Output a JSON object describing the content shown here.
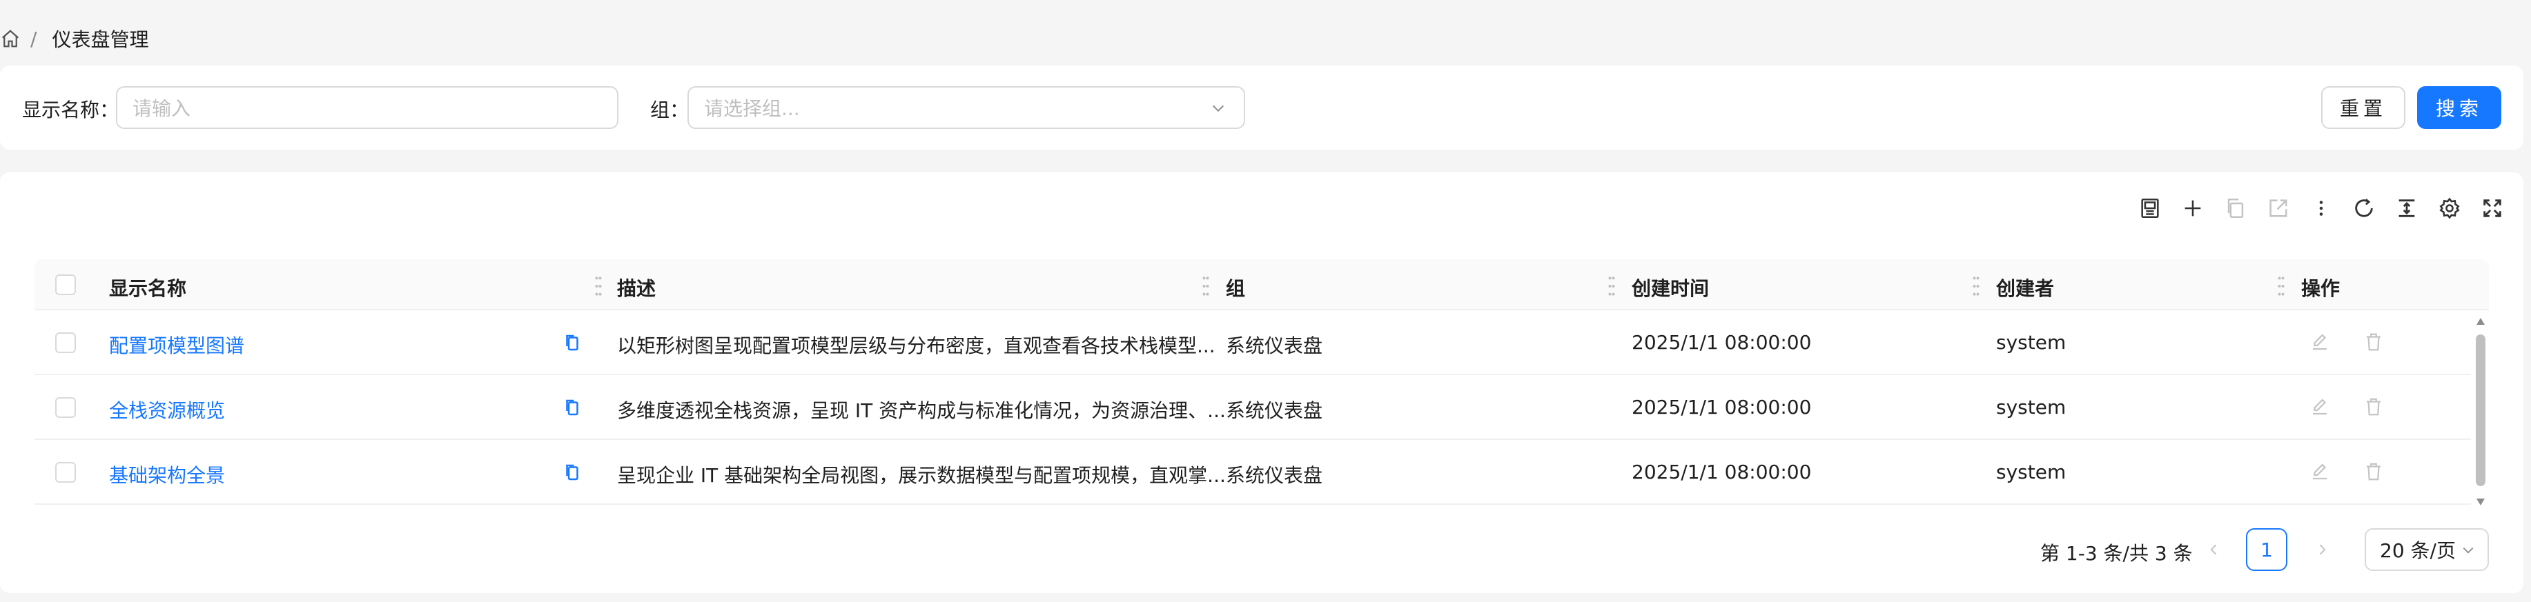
{
  "breadcrumb": {
    "separator": "/",
    "current": "仪表盘管理"
  },
  "search": {
    "name_label": "显示名称：",
    "name_placeholder": "请输入",
    "group_label": "组：",
    "group_placeholder": "请选择组...",
    "reset_label": "重置",
    "search_label": "搜索"
  },
  "toolbar": {
    "icons": [
      "import-icon",
      "add-icon",
      "copy-icon",
      "export-icon",
      "more-icon",
      "reload-icon",
      "density-icon",
      "settings-icon",
      "fullscreen-icon"
    ]
  },
  "table": {
    "columns": [
      "显示名称",
      "描述",
      "组",
      "创建时间",
      "创建者",
      "操作"
    ],
    "rows": [
      {
        "name": "配置项模型图谱",
        "desc": "以矩形树图呈现配置项模型层级与分布密度，直观查看各技术栈模型...",
        "group": "系统仪表盘",
        "created": "2025/1/1 08:00:00",
        "creator": "system"
      },
      {
        "name": "全栈资源概览",
        "desc": "多维度透视全栈资源，呈现 IT 资产构成与标准化情况，为资源治理、...",
        "group": "系统仪表盘",
        "created": "2025/1/1 08:00:00",
        "creator": "system"
      },
      {
        "name": "基础架构全景",
        "desc": "呈现企业 IT 基础架构全局视图，展示数据模型与配置项规模，直观掌...",
        "group": "系统仪表盘",
        "created": "2025/1/1 08:00:00",
        "creator": "system"
      }
    ]
  },
  "pagination": {
    "total_text": "第 1-3 条/共 3 条",
    "current_page": "1",
    "page_size": "20 条/页"
  },
  "colors": {
    "primary": "#1677ff",
    "border": "#d9d9d9"
  }
}
